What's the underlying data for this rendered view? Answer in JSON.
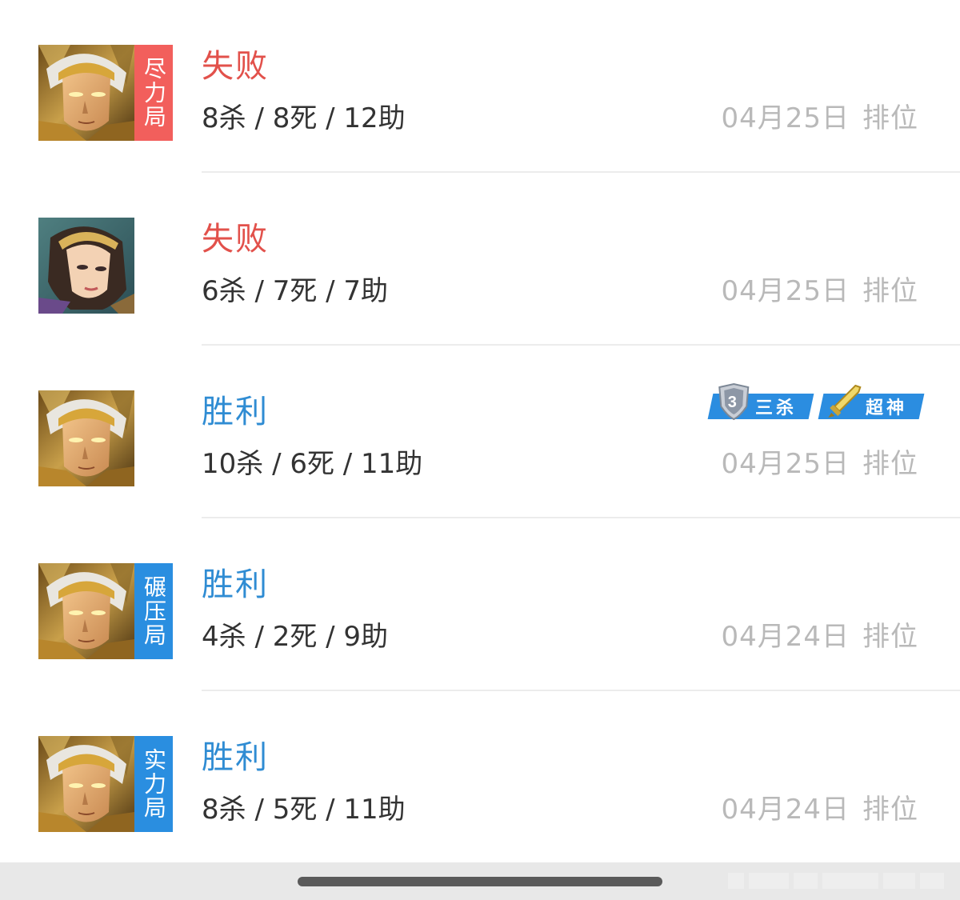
{
  "matches": [
    {
      "result": "失败",
      "result_type": "lose",
      "tag": "尽力局",
      "tag_color": "#f25f5c",
      "hero": "golden-warrior",
      "kda": "8杀 / 8死 / 12助",
      "date": "04月25日",
      "mode": "排位"
    },
    {
      "result": "失败",
      "result_type": "lose",
      "tag": "",
      "hero": "dark-haired-heroine",
      "kda": "6杀 / 7死 / 7助",
      "date": "04月25日",
      "mode": "排位"
    },
    {
      "result": "胜利",
      "result_type": "win",
      "tag": "",
      "hero": "golden-warrior",
      "kda": "10杀 / 6死 / 11助",
      "date": "04月25日",
      "mode": "排位",
      "badges": [
        {
          "icon": "shield-3-icon",
          "label": "三杀"
        },
        {
          "icon": "sword-icon",
          "label": "超神"
        }
      ]
    },
    {
      "result": "胜利",
      "result_type": "win",
      "tag": "碾压局",
      "tag_color": "#2a8ee0",
      "hero": "golden-warrior",
      "kda": "4杀 / 2死 / 9助",
      "date": "04月24日",
      "mode": "排位"
    },
    {
      "result": "胜利",
      "result_type": "win",
      "tag": "实力局",
      "tag_color": "#2a8ee0",
      "hero": "golden-warrior",
      "kda": "8杀 / 5死 / 11助",
      "date": "04月24日",
      "mode": "排位"
    }
  ],
  "colors": {
    "lose": "#e2514b",
    "win": "#2f8cd3",
    "meta": "#b9b9b9",
    "badge": "#2b8de0"
  }
}
